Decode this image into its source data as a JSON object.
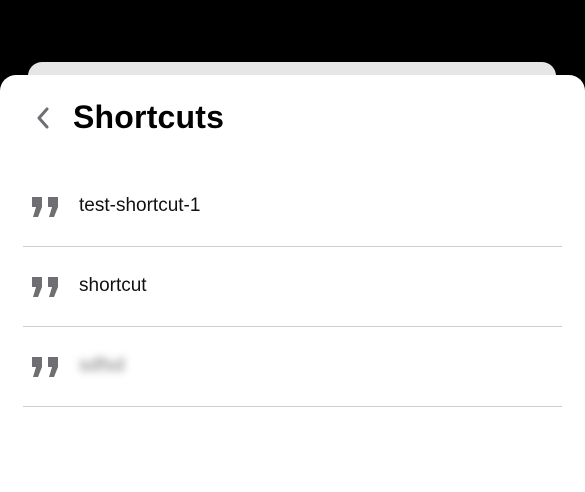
{
  "header": {
    "title": "Shortcuts",
    "back_icon": "chevron-left-icon"
  },
  "shortcuts": [
    {
      "label": "test-shortcut-1",
      "icon": "quote-icon",
      "blurred": false
    },
    {
      "label": "shortcut",
      "icon": "quote-icon",
      "blurred": false
    },
    {
      "label": "sdfsd",
      "icon": "quote-icon",
      "blurred": true
    }
  ],
  "colors": {
    "background": "#000000",
    "sheet": "#ffffff",
    "icon": "#6e6e73",
    "divider": "#cfcfcf"
  }
}
